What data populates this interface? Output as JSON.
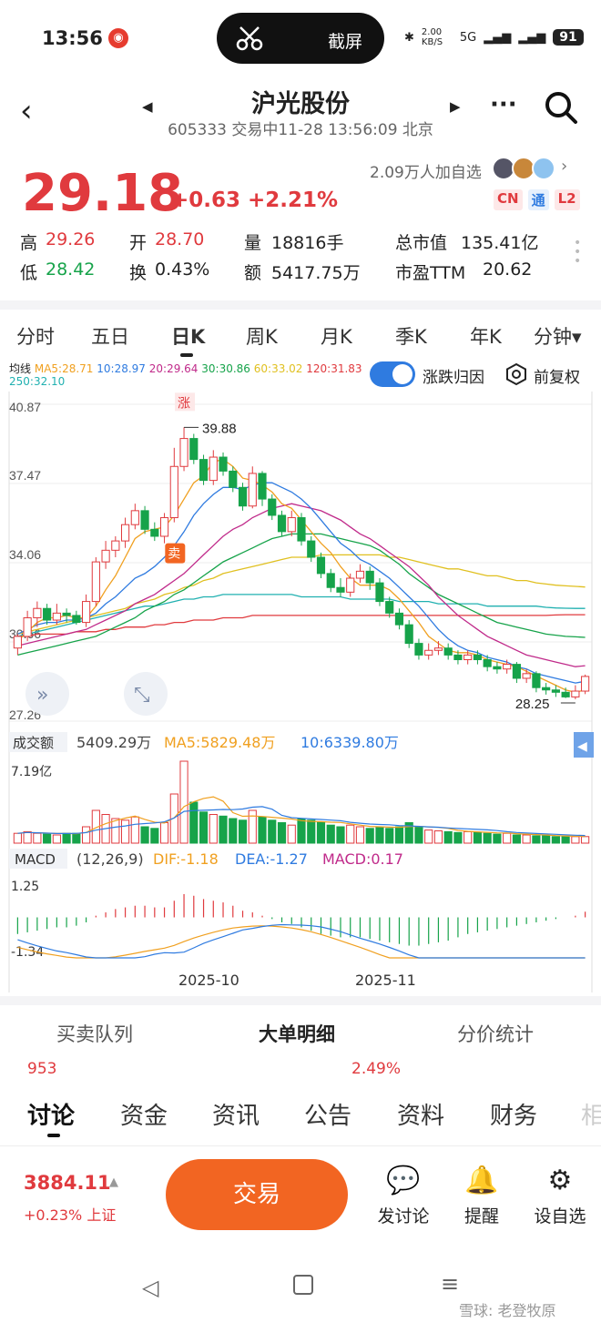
{
  "status": {
    "time": "13:56",
    "screenshot_label": "截屏",
    "net": "2.00 KB/S",
    "signal": "5G",
    "battery": "91"
  },
  "header": {
    "title": "沪光股份",
    "subtitle": "605333 交易中11-28 13:56:09 北京"
  },
  "quote": {
    "price": "29.18",
    "change": "+0.63 +2.21%",
    "watchers": "2.09万人加自选",
    "badges": [
      "CN",
      "通",
      "L2"
    ]
  },
  "stats": {
    "high_label": "高",
    "high": "29.26",
    "open_label": "开",
    "open": "28.70",
    "vol_label": "量",
    "vol": "18816手",
    "cap_label": "总市值",
    "cap": "135.41亿",
    "low_label": "低",
    "low": "28.42",
    "turn_label": "换",
    "turn": "0.43%",
    "amt_label": "额",
    "amt": "5417.75万",
    "pe_label": "市盈TTM",
    "pe": "20.62"
  },
  "tabs": [
    "分时",
    "五日",
    "日K",
    "周K",
    "月K",
    "季K",
    "年K",
    "分钟▾"
  ],
  "ma": {
    "label": "均线",
    "ma5": "MA5:28.71",
    "ma10": "10:28.97",
    "ma20": "20:29.64",
    "ma30": "30:30.86",
    "ma60": "60:33.02",
    "ma120": "120:31.83",
    "ma250": "250:32.10"
  },
  "chart_controls": {
    "toggle_label": "涨跌归因",
    "adjust_label": "前复权"
  },
  "chart_data": {
    "type": "candlestick",
    "y_axis": [
      "40.87",
      "37.47",
      "34.06",
      "30.66",
      "27.26"
    ],
    "ylim": [
      27.26,
      40.87
    ],
    "high_marker": "39.88",
    "low_marker": "28.25",
    "rise_tag": "涨",
    "sell_tag": "卖",
    "x_ticks": [
      "2025-10",
      "2025-11"
    ],
    "candles": [
      [
        30.4,
        30.9,
        30.1,
        31.0
      ],
      [
        30.9,
        31.7,
        30.7,
        32.0
      ],
      [
        31.7,
        32.1,
        31.3,
        32.4
      ],
      [
        32.1,
        31.6,
        31.4,
        32.3
      ],
      [
        31.6,
        31.9,
        31.4,
        32.3
      ],
      [
        31.9,
        31.8,
        31.5,
        32.1
      ],
      [
        31.8,
        31.5,
        31.4,
        32.0
      ],
      [
        31.5,
        32.4,
        31.3,
        32.7
      ],
      [
        32.4,
        34.1,
        32.2,
        34.3
      ],
      [
        34.1,
        34.6,
        33.8,
        35.0
      ],
      [
        34.6,
        35.0,
        34.3,
        35.2
      ],
      [
        35.0,
        35.7,
        34.7,
        36.0
      ],
      [
        35.7,
        36.3,
        35.5,
        36.6
      ],
      [
        36.3,
        35.5,
        35.3,
        36.5
      ],
      [
        35.5,
        35.2,
        35.0,
        35.8
      ],
      [
        35.2,
        36.0,
        34.9,
        36.2
      ],
      [
        36.0,
        38.2,
        35.8,
        39.0
      ],
      [
        38.2,
        39.4,
        38.0,
        39.88
      ],
      [
        39.4,
        38.5,
        38.3,
        39.6
      ],
      [
        38.5,
        37.6,
        37.4,
        38.7
      ],
      [
        37.6,
        38.6,
        37.4,
        38.9
      ],
      [
        38.6,
        38.0,
        37.8,
        38.8
      ],
      [
        38.0,
        37.3,
        37.1,
        38.2
      ],
      [
        37.3,
        36.5,
        36.3,
        37.5
      ],
      [
        36.5,
        37.9,
        36.4,
        38.2
      ],
      [
        37.9,
        36.8,
        36.5,
        38.0
      ],
      [
        36.8,
        36.1,
        35.9,
        37.0
      ],
      [
        36.1,
        35.4,
        35.2,
        36.3
      ],
      [
        35.4,
        36.0,
        35.2,
        36.3
      ],
      [
        36.0,
        35.0,
        34.8,
        36.2
      ],
      [
        35.0,
        34.3,
        34.1,
        35.2
      ],
      [
        34.3,
        33.6,
        33.4,
        34.5
      ],
      [
        33.6,
        33.0,
        32.8,
        33.8
      ],
      [
        33.0,
        32.8,
        32.6,
        33.4
      ],
      [
        32.8,
        33.4,
        32.6,
        33.6
      ],
      [
        33.4,
        33.7,
        33.2,
        34.0
      ],
      [
        33.7,
        33.2,
        32.9,
        33.9
      ],
      [
        33.2,
        32.4,
        32.2,
        33.4
      ],
      [
        32.4,
        31.9,
        31.7,
        32.6
      ],
      [
        31.9,
        31.4,
        31.2,
        32.1
      ],
      [
        31.4,
        30.6,
        30.4,
        31.6
      ],
      [
        30.6,
        30.1,
        29.9,
        30.8
      ],
      [
        30.1,
        30.3,
        29.9,
        30.6
      ],
      [
        30.3,
        30.4,
        30.1,
        30.7
      ],
      [
        30.4,
        30.1,
        29.9,
        30.6
      ],
      [
        30.1,
        29.9,
        29.7,
        30.3
      ],
      [
        29.9,
        30.1,
        29.7,
        30.3
      ],
      [
        30.1,
        29.9,
        29.7,
        30.3
      ],
      [
        29.9,
        29.6,
        29.4,
        30.1
      ],
      [
        29.6,
        29.5,
        29.3,
        29.8
      ],
      [
        29.5,
        29.7,
        29.3,
        29.9
      ],
      [
        29.7,
        29.1,
        28.9,
        29.8
      ],
      [
        29.1,
        29.3,
        28.9,
        29.5
      ],
      [
        29.3,
        28.7,
        28.5,
        29.4
      ],
      [
        28.7,
        28.6,
        28.4,
        28.9
      ],
      [
        28.6,
        28.5,
        28.3,
        28.8
      ],
      [
        28.5,
        28.3,
        28.25,
        28.7
      ],
      [
        28.3,
        28.55,
        28.2,
        28.8
      ],
      [
        28.55,
        29.18,
        28.42,
        29.26
      ]
    ],
    "ma5": [
      30.7,
      31.1,
      31.5,
      31.7,
      31.7,
      31.8,
      31.7,
      31.7,
      32.2,
      32.9,
      33.5,
      34.3,
      35.1,
      35.4,
      35.5,
      35.6,
      36.1,
      36.8,
      37.5,
      37.8,
      38.4,
      38.5,
      38.2,
      37.7,
      37.6,
      37.4,
      37.1,
      36.6,
      36.4,
      35.9,
      35.4,
      34.9,
      34.5,
      33.9,
      33.4,
      33.1,
      33.1,
      33.1,
      32.9,
      32.5,
      32.0,
      31.5,
      30.9,
      30.6,
      30.3,
      30.2,
      30.2,
      30.1,
      29.9,
      29.8,
      29.7,
      29.6,
      29.4,
      29.2,
      29.0,
      28.8,
      28.6,
      28.5,
      28.6
    ],
    "ma10": [
      31.0,
      31.2,
      31.4,
      31.5,
      31.5,
      31.6,
      31.6,
      31.7,
      31.9,
      32.3,
      32.6,
      33.0,
      33.4,
      33.6,
      33.9,
      34.3,
      34.8,
      35.4,
      36.1,
      36.6,
      37.0,
      37.3,
      37.3,
      37.2,
      37.4,
      37.5,
      37.5,
      37.3,
      37.1,
      36.8,
      36.4,
      35.9,
      35.4,
      34.9,
      34.6,
      34.2,
      34.0,
      33.7,
      33.4,
      33.0,
      32.6,
      32.2,
      31.7,
      31.2,
      30.8,
      30.5,
      30.3,
      30.2,
      30.0,
      29.9,
      29.8,
      29.6,
      29.5,
      29.3,
      29.2,
      29.1,
      29.0,
      28.9,
      28.97
    ],
    "ma20": [
      30.5,
      30.6,
      30.7,
      30.8,
      30.9,
      31.0,
      31.1,
      31.2,
      31.4,
      31.6,
      31.8,
      32.0,
      32.3,
      32.5,
      32.7,
      33.0,
      33.3,
      33.6,
      34.0,
      34.4,
      34.8,
      35.2,
      35.5,
      35.7,
      36.0,
      36.2,
      36.4,
      36.5,
      36.6,
      36.5,
      36.4,
      36.3,
      36.1,
      35.9,
      35.6,
      35.3,
      35.1,
      34.8,
      34.5,
      34.2,
      33.9,
      33.5,
      33.1,
      32.6,
      32.2,
      31.8,
      31.5,
      31.2,
      30.9,
      30.7,
      30.5,
      30.3,
      30.1,
      30.0,
      29.9,
      29.8,
      29.7,
      29.6,
      29.64
    ],
    "ma30": [
      30.1,
      30.2,
      30.3,
      30.4,
      30.5,
      30.6,
      30.7,
      30.8,
      30.9,
      31.1,
      31.3,
      31.5,
      31.7,
      32.0,
      32.2,
      32.4,
      32.7,
      32.9,
      33.2,
      33.5,
      33.8,
      34.1,
      34.3,
      34.5,
      34.7,
      34.9,
      35.1,
      35.2,
      35.3,
      35.3,
      35.3,
      35.3,
      35.2,
      35.1,
      35.0,
      34.9,
      34.8,
      34.6,
      34.3,
      34.0,
      33.6,
      33.3,
      33.0,
      32.7,
      32.5,
      32.3,
      32.1,
      31.9,
      31.7,
      31.5,
      31.4,
      31.3,
      31.2,
      31.1,
      31.0,
      30.95,
      30.9,
      30.88,
      30.86
    ],
    "ma60": [
      31.0,
      31.1,
      31.2,
      31.3,
      31.4,
      31.5,
      31.6,
      31.7,
      31.8,
      31.9,
      32.0,
      32.1,
      32.3,
      32.4,
      32.5,
      32.7,
      32.8,
      33.0,
      33.1,
      33.3,
      33.4,
      33.6,
      33.7,
      33.8,
      33.9,
      34.0,
      34.1,
      34.2,
      34.3,
      34.3,
      34.3,
      34.4,
      34.4,
      34.4,
      34.4,
      34.4,
      34.4,
      34.4,
      34.3,
      34.3,
      34.2,
      34.1,
      34.0,
      33.9,
      33.8,
      33.8,
      33.7,
      33.6,
      33.5,
      33.5,
      33.4,
      33.3,
      33.3,
      33.2,
      33.15,
      33.1,
      33.07,
      33.05,
      33.02
    ],
    "ma120": [
      30.9,
      30.9,
      31.0,
      31.0,
      31.0,
      31.0,
      31.1,
      31.1,
      31.1,
      31.2,
      31.2,
      31.3,
      31.3,
      31.3,
      31.4,
      31.4,
      31.5,
      31.5,
      31.6,
      31.6,
      31.6,
      31.7,
      31.7,
      31.7,
      31.8,
      31.8,
      31.8,
      31.8,
      31.8,
      31.8,
      31.8,
      31.8,
      31.8,
      31.8,
      31.8,
      31.8,
      31.8,
      31.8,
      31.8,
      31.8,
      31.8,
      31.8,
      31.8,
      31.8,
      31.8,
      31.8,
      31.8,
      31.8,
      31.8,
      31.8,
      31.8,
      31.8,
      31.8,
      31.8,
      31.8,
      31.82,
      31.83,
      31.83,
      31.83
    ],
    "ma250": [
      30.9,
      31.0,
      31.1,
      31.2,
      31.3,
      31.4,
      31.5,
      31.6,
      31.7,
      31.8,
      31.9,
      32.0,
      32.1,
      32.2,
      32.2,
      32.3,
      32.4,
      32.5,
      32.5,
      32.6,
      32.6,
      32.7,
      32.7,
      32.7,
      32.7,
      32.7,
      32.7,
      32.7,
      32.7,
      32.6,
      32.6,
      32.6,
      32.6,
      32.6,
      32.5,
      32.5,
      32.5,
      32.5,
      32.5,
      32.4,
      32.4,
      32.4,
      32.4,
      32.3,
      32.3,
      32.3,
      32.3,
      32.3,
      32.2,
      32.2,
      32.2,
      32.2,
      32.2,
      32.2,
      32.15,
      32.12,
      32.11,
      32.1,
      32.1
    ],
    "volume": {
      "label": "成交额",
      "value": "5409.29万",
      "ma5": "MA5:5829.48万",
      "ma10": "10:6339.80万",
      "ymax": "7.19亿",
      "bars": [
        0.12,
        0.14,
        0.12,
        0.11,
        0.1,
        0.12,
        0.12,
        0.2,
        0.4,
        0.35,
        0.3,
        0.28,
        0.32,
        0.2,
        0.18,
        0.25,
        0.6,
        1.0,
        0.5,
        0.38,
        0.35,
        0.33,
        0.3,
        0.28,
        0.4,
        0.32,
        0.28,
        0.25,
        0.22,
        0.3,
        0.28,
        0.26,
        0.22,
        0.2,
        0.22,
        0.2,
        0.18,
        0.2,
        0.18,
        0.2,
        0.25,
        0.2,
        0.16,
        0.15,
        0.14,
        0.13,
        0.14,
        0.13,
        0.12,
        0.11,
        0.12,
        0.1,
        0.1,
        0.09,
        0.09,
        0.08,
        0.08,
        0.08,
        0.08
      ]
    },
    "macd": {
      "label": "MACD",
      "params": "(12,26,9)",
      "dif": "DIF:-1.18",
      "dea": "DEA:-1.27",
      "macd": "MACD:0.17",
      "ymax": "1.25",
      "ymin": "-1.34",
      "hist": [
        -0.5,
        -0.45,
        -0.4,
        -0.35,
        -0.3,
        -0.3,
        -0.25,
        -0.15,
        0.05,
        0.15,
        0.25,
        0.3,
        0.35,
        0.35,
        0.3,
        0.3,
        0.5,
        0.7,
        0.65,
        0.55,
        0.5,
        0.45,
        0.35,
        0.2,
        0.15,
        0.05,
        -0.05,
        -0.15,
        -0.2,
        -0.3,
        -0.4,
        -0.5,
        -0.55,
        -0.6,
        -0.6,
        -0.6,
        -0.65,
        -0.7,
        -0.75,
        -0.8,
        -0.85,
        -0.85,
        -0.8,
        -0.75,
        -0.7,
        -0.6,
        -0.5,
        -0.45,
        -0.4,
        -0.35,
        -0.3,
        -0.25,
        -0.2,
        -0.15,
        -0.1,
        -0.05,
        0.0,
        0.05,
        0.17
      ]
    }
  },
  "lower_tabs": [
    "买卖队列",
    "大单明细",
    "分价统计"
  ],
  "lower_preview": {
    "left": "953",
    "right": "2.49%"
  },
  "bottom_tabs": [
    "讨论",
    "资金",
    "资讯",
    "公告",
    "资料",
    "财务",
    "相"
  ],
  "footer": {
    "index_value": "3884.11",
    "index_change": "+0.23% 上证",
    "trade": "交易",
    "post": "发讨论",
    "remind": "提醒",
    "watch": "设自选"
  },
  "watermark": "雪球: 老登牧原"
}
